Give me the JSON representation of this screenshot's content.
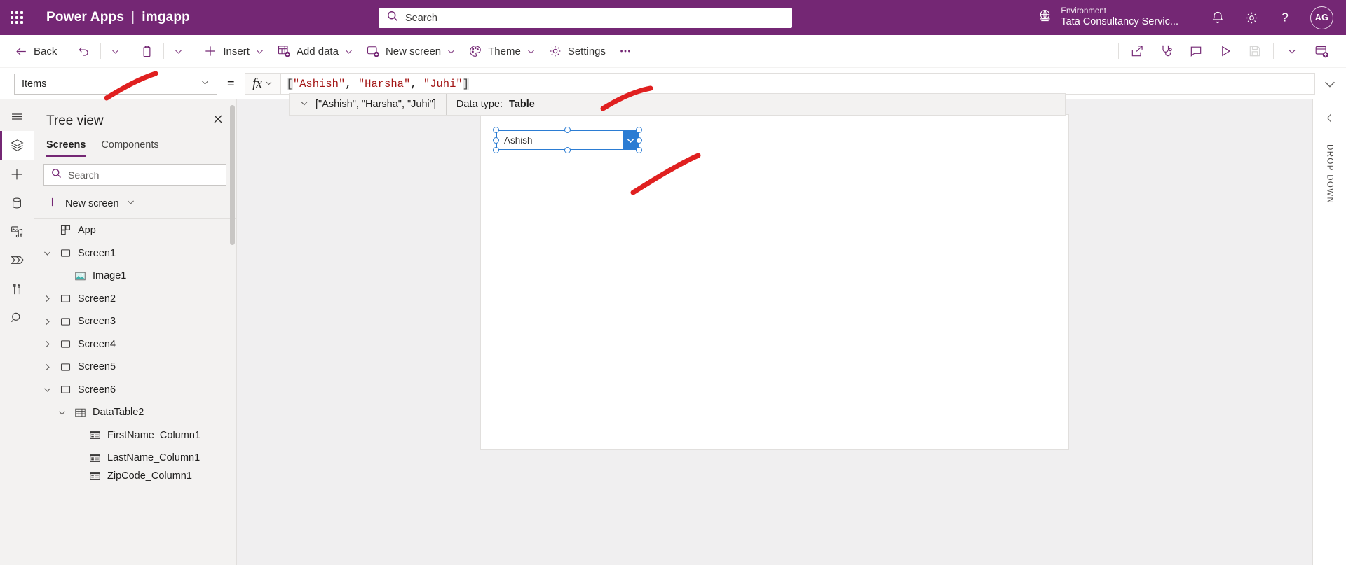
{
  "header": {
    "waffle_icon": "waffle-icon",
    "brand": "Power Apps",
    "separator": "|",
    "app_name": "imgapp",
    "search_placeholder": "Search",
    "search_icon": "search-icon",
    "environment_icon": "globe-icon",
    "environment_label": "Environment",
    "environment_name": "Tata Consultancy Servic...",
    "bell_icon": "bell-icon",
    "gear_icon": "gear-icon",
    "help_icon": "question-mark-icon",
    "avatar_initials": "AG",
    "bg_color": "#742774"
  },
  "commandbar": {
    "back": "Back",
    "back_icon": "arrow-left-icon",
    "undo_icon": "undo-icon",
    "undo_chevron_icon": "chevron-down-icon",
    "paste_icon": "clipboard-icon",
    "paste_chevron_icon": "chevron-down-icon",
    "insert": "Insert",
    "insert_icon": "plus-icon",
    "add_data": "Add data",
    "add_data_icon": "add-data-table-icon",
    "new_screen": "New screen",
    "new_screen_icon": "new-screen-icon",
    "theme": "Theme",
    "theme_icon": "palette-icon",
    "settings": "Settings",
    "settings_icon": "gear-icon",
    "overflow_icon": "ellipsis-icon",
    "right_icons": [
      "share-icon",
      "app-checker-stethoscope-icon",
      "comment-icon",
      "play-preview-icon",
      "save-icon",
      "chevron-down-icon",
      "publish-icon"
    ]
  },
  "formulabar": {
    "property": "Items",
    "property_chevron_icon": "chevron-down-icon",
    "equals": "=",
    "fx_glyph": "fx",
    "fx_chevron_icon": "chevron-down-icon",
    "formula_tokens": [
      {
        "text": "[",
        "kind": "bracket"
      },
      {
        "text": "\"Ashish\"",
        "kind": "string"
      },
      {
        "text": ", ",
        "kind": "punct"
      },
      {
        "text": "\"Harsha\"",
        "kind": "string"
      },
      {
        "text": ", ",
        "kind": "punct"
      },
      {
        "text": "\"Juhi\"",
        "kind": "string"
      },
      {
        "text": "]",
        "kind": "bracket"
      }
    ],
    "formula_plain": "[\"Ashish\", \"Harsha\", \"Juhi\"]",
    "collapse_icon": "chevron-down-icon"
  },
  "resultbar": {
    "expand_icon": "chevron-down-icon",
    "result_value": "[\"Ashish\", \"Harsha\", \"Juhi\"]",
    "datatype_label": "Data type:",
    "datatype_value": "Table"
  },
  "rail": {
    "items": [
      {
        "icon": "hamburger-menu-icon",
        "active": false
      },
      {
        "icon": "tree-view-layers-icon",
        "active": true
      },
      {
        "icon": "insert-plus-icon",
        "active": false
      },
      {
        "icon": "data-cylinder-icon",
        "active": false
      },
      {
        "icon": "media-icon",
        "active": false
      },
      {
        "icon": "power-automate-flow-icon",
        "active": false
      },
      {
        "icon": "advanced-tools-icon",
        "active": false
      },
      {
        "icon": "search-icon",
        "active": false
      }
    ]
  },
  "treeview": {
    "title": "Tree view",
    "close_icon": "close-icon",
    "tabs": [
      {
        "label": "Screens",
        "selected": true
      },
      {
        "label": "Components",
        "selected": false
      }
    ],
    "search_placeholder": "Search",
    "search_icon": "search-icon",
    "new_screen_label": "New screen",
    "new_screen_icon": "plus-icon",
    "new_screen_chevron_icon": "chevron-down-icon",
    "items": [
      {
        "label": "App",
        "icon": "app-icon",
        "indent": 0,
        "twist": "none",
        "partial": false
      },
      {
        "label": "Screen1",
        "icon": "screen-icon",
        "indent": 0,
        "twist": "expanded",
        "partial": false
      },
      {
        "label": "Image1",
        "icon": "image-icon",
        "indent": 1,
        "twist": "none",
        "partial": false
      },
      {
        "label": "Screen2",
        "icon": "screen-icon",
        "indent": 0,
        "twist": "collapsed",
        "partial": false
      },
      {
        "label": "Screen3",
        "icon": "screen-icon",
        "indent": 0,
        "twist": "collapsed",
        "partial": false
      },
      {
        "label": "Screen4",
        "icon": "screen-icon",
        "indent": 0,
        "twist": "collapsed",
        "partial": false
      },
      {
        "label": "Screen5",
        "icon": "screen-icon",
        "indent": 0,
        "twist": "collapsed",
        "partial": false
      },
      {
        "label": "Screen6",
        "icon": "screen-icon",
        "indent": 0,
        "twist": "expanded",
        "partial": false
      },
      {
        "label": "DataTable2",
        "icon": "datatable-icon",
        "indent": 1,
        "twist": "expanded",
        "partial": false
      },
      {
        "label": "FirstName_Column1",
        "icon": "column-icon",
        "indent": 2,
        "twist": "none",
        "partial": false
      },
      {
        "label": "LastName_Column1",
        "icon": "column-icon",
        "indent": 2,
        "twist": "none",
        "partial": false
      },
      {
        "label": "ZipCode_Column1",
        "icon": "column-icon",
        "indent": 2,
        "twist": "none",
        "partial": true
      }
    ]
  },
  "canvas": {
    "dropdown": {
      "selected_value": "Ashish",
      "chevron_icon": "chevron-down-icon",
      "selection_color": "#2b7cd3"
    }
  },
  "rightpanel": {
    "collapse_icon": "chevron-left-icon",
    "label": "DROP DOWN"
  },
  "annotations": {
    "color": "#e02020",
    "strokes": [
      "property-selector-arrow",
      "formula-bar-arrow",
      "dropdown-control-arrow"
    ]
  }
}
